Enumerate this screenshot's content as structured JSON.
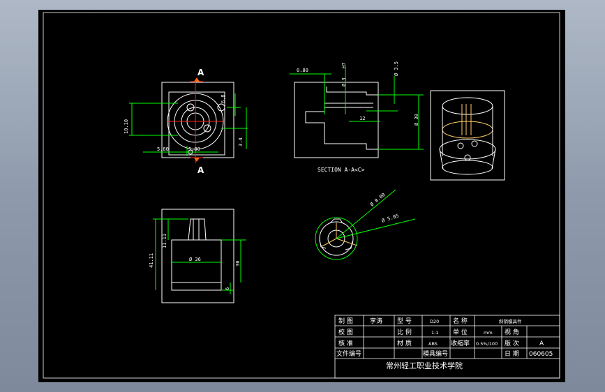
{
  "section_labels": {
    "cut_top": "A",
    "cut_bottom": "A",
    "section_title": "SECTION A-A<C>"
  },
  "dimensions": {
    "top_view": {
      "height_left": "10.10",
      "small_right": "6.8",
      "offset_right": "3.4",
      "width_left": "5.80",
      "width_right": "5.80"
    },
    "section_view": {
      "wall": "0.80",
      "hole_dia": "Ø 3",
      "fit": "H7",
      "dia_small": "Ø 3.5",
      "length": "12",
      "outer_dia": "Ø 30"
    },
    "front_view": {
      "total_height": "41.11",
      "neck_height": "11.11",
      "body_dia": "Ø 36",
      "body_height": "30",
      "base_height": "6"
    },
    "detail_view": {
      "dia_a": "Ø 8.00",
      "dia_b": "Ø 5.05"
    }
  },
  "title_block": {
    "row1": {
      "label_a": "制 图",
      "value_a": "李涛",
      "label_b": "型 号",
      "value_b": "D20",
      "label_c": "名 称",
      "value_c": "斜销模具件"
    },
    "row2": {
      "label_a": "校 图",
      "value_a": "",
      "label_b": "比 例",
      "value_b": "1:1",
      "label_c": "单 位",
      "value_c": "mm",
      "label_d": "视 角",
      "value_d": ""
    },
    "row3": {
      "label_a": "核 准",
      "value_a": "",
      "label_b": "材 质",
      "value_b": "ABS",
      "label_c": "收缩率",
      "value_c": "0.5%/100",
      "label_d": "版 次",
      "value_d": "A"
    },
    "row4": {
      "label_a": "文件编号",
      "value_a": "",
      "label_b": "模具编号",
      "value_b": "",
      "label_c": "日 期",
      "value_c": "060605"
    },
    "school": "常州轻工职业技术学院"
  }
}
